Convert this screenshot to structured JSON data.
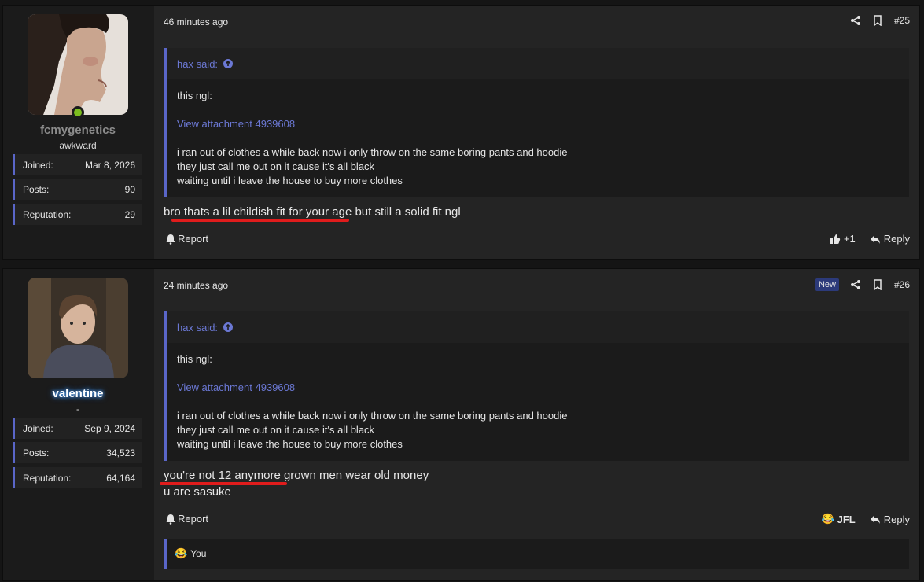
{
  "posts": [
    {
      "username": "fcmygenetics",
      "user_title": "awkward",
      "stats": [
        {
          "label": "Joined:",
          "value": "Mar 8, 2026"
        },
        {
          "label": "Posts:",
          "value": "90"
        },
        {
          "label": "Reputation:",
          "value": "29"
        }
      ],
      "date": "46 minutes ago",
      "post_number": "#25",
      "quote": {
        "author": "hax said:",
        "line1": "this ngl:",
        "attachment": "View attachment 4939608",
        "lines": [
          "i ran out of clothes a while back now i only throw on the same boring pants and hoodie",
          "they just call me out on it cause it's all black",
          "waiting until i leave the house to buy more clothes"
        ]
      },
      "message": [
        "bro thats a lil childish fit for your age but still a solid fit ngl"
      ],
      "report_label": "Report",
      "reaction_count": "+1",
      "reply_label": "Reply"
    },
    {
      "username": "valentine",
      "user_title": "-",
      "stats": [
        {
          "label": "Joined:",
          "value": "Sep 9, 2024"
        },
        {
          "label": "Posts:",
          "value": "34,523"
        },
        {
          "label": "Reputation:",
          "value": "64,164"
        }
      ],
      "date": "24 minutes ago",
      "new_badge": "New",
      "post_number": "#26",
      "quote": {
        "author": "hax said:",
        "line1": "this ngl:",
        "attachment": "View attachment 4939608",
        "lines": [
          "i ran out of clothes a while back now i only throw on the same boring pants and hoodie",
          "they just call me out on it cause it's all black",
          "waiting until i leave the house to buy more clothes"
        ]
      },
      "message": [
        "you're not 12 anymore grown men wear old money",
        "u are sasuke"
      ],
      "report_label": "Report",
      "reaction_label": "JFL",
      "reply_label": "Reply",
      "reactions_bar": "You"
    }
  ],
  "colors": {
    "accent": "#5a66c8",
    "link": "#6b78d4",
    "online": "#7cbc1e",
    "underline": "#e01c1c"
  }
}
